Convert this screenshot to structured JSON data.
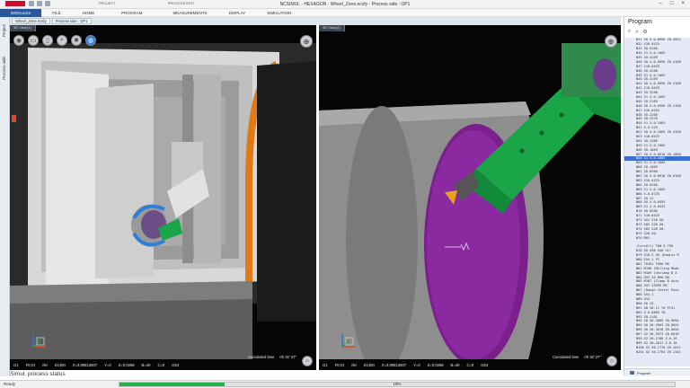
{
  "window": {
    "title": "NCSIMUL - HEXAGON - Wheel_Zone.ncsfy - Process side : OP1",
    "context_groups": [
      "PROJECT",
      "PROCESS EDIT"
    ]
  },
  "menu_tabs": [
    "MODULES",
    "FILE",
    "HOME",
    "PROGRAM",
    "MEASUREMENTS",
    "DISPLAY",
    "SIMULATION"
  ],
  "left_strip": {
    "project_label": "Project",
    "process_label": "Process side"
  },
  "doc_tabs": [
    "Wheel_Zone.ncsfy",
    "Process side : OP1"
  ],
  "viewport1": {
    "title": "3D View(1)",
    "status": [
      "G1",
      "F0.01",
      "N0",
      "S1460",
      "X=3.89812607",
      "Y=0"
    ],
    "status2": [
      "Z=0.0268",
      "B=40",
      "C=0",
      "G54"
    ],
    "cumulated_label": "Cumulated time",
    "cumulated_value": "0h 32' 27\""
  },
  "viewport2": {
    "title": "3D View(2)",
    "status": [
      "G1",
      "F0.01",
      "N0",
      "S1460",
      "X=3.89812607",
      "Y=0"
    ],
    "status2": [
      "Z=0.0268",
      "B=40",
      "C=0",
      "G54"
    ],
    "cumulated_label": "Cumulated time",
    "cumulated_value": "0h 32' 27\""
  },
  "toolbar_icons": [
    "camera-icon",
    "folder-icon",
    "file-icon",
    "zoom-icon",
    "gear-icon",
    "globe-icon"
  ],
  "program": {
    "title": "Program",
    "footer_tab": "Program",
    "highlight_index": 27,
    "lines": [
      "N31 S0 X-0.0956 Z0.5032",
      "N32 X10.0425",
      "N33 Z0.5168",
      "N34 S1 X-0.1065",
      "N35 Z0.4169",
      "N36 S0 X-0.0956 Z0.4168",
      "N37 X10.0425",
      "N38 Z0.4268",
      "N39 S1 X-0.1065",
      "N40 Z0.3169",
      "N41 S0 X-0.0956 Z0.3168",
      "N42 X10.0425",
      "N43 Z0.3268",
      "N44 S1 X-0.1065",
      "N45 Z0.2169",
      "N46 S0 X-0.0956 Z0.2168",
      "N47 X10.0425",
      "N48 Z0.2268",
      "N49 Z0.2370",
      "N50 S1 X-0.1065",
      "N51 X-0.229",
      "N52 S0 X-0.1065 Z0.5268",
      "N53 X10.0425",
      "N54 Z0.1268",
      "N55 S1 X-0.1065",
      "N56 Z0.1069",
      "N57 S0 X-0.0918 Z0.1068",
      "N58 S1 X-0.1065",
      "N59 S1 X-0.1065",
      "N60 Z0.1069",
      "N61 Z0.0268",
      "N62 S0 X-0.0918 Z0.0168",
      "N63 X10.0425",
      "N64 Z0.0268",
      "N65 S1 X-0.1065",
      "N66 X-0.0725",
      "N67 Z0.11",
      "N68 S0 X-0.0495",
      "N69 S1 X-0.0425",
      "N70 Z0.0268",
      "N71 X10.0425",
      "N72 S01 G18 X0.",
      "N73 S0S G28 X0.",
      "N74 S05 G28 X0.",
      "N75 G28 X0.",
      "N76 M01",
      "",
      "(Cornell) T00 0.75D",
      "N78 G0 G98 G40 G17",
      "N79 G18.5 X0 (Radius M",
      "N80 G54.1 P1",
      "N81 T0101 T006 M6",
      "N82 M108 (Milling Mode",
      "N83 M109 (Unclamp B A",
      "N84 G53 X0 B90 B0",
      "N85 M107 (Clamp B Axis",
      "N86 G97 S3999 M3",
      "N87 (Rough Center Pock",
      "N88 G54.1",
      "N89 G54",
      "N90 G0 C0.",
      "N91 G0 X0.11 Y0 P131",
      "N92 Z-0.0865 Y0.",
      "N93 Z0.1101",
      "N94 G0 X0.3809 Z0.0054",
      "N95 G0 X0.3963 Z0.0034",
      "N96 G0 X0.3618 Z0.0034",
      "N97 G2 X0.3973 Z0.0018",
      "N98 G2 X0.2786 Z-0.10",
      "N99 G2 X0.2611 Z-0.10",
      "N100 G2 X0.1776 Z0.1012",
      "N101 G2 X0.1764 Z0.1101"
    ]
  },
  "simul_label": "Simul. process status",
  "status": {
    "ready": "Ready",
    "progress_percent": "19%",
    "progress_value": 0.19
  },
  "colors": {
    "accent": "#2b5797",
    "progress": "#27b34b",
    "part": "#7a1f8c",
    "tool": "#1aa548"
  }
}
